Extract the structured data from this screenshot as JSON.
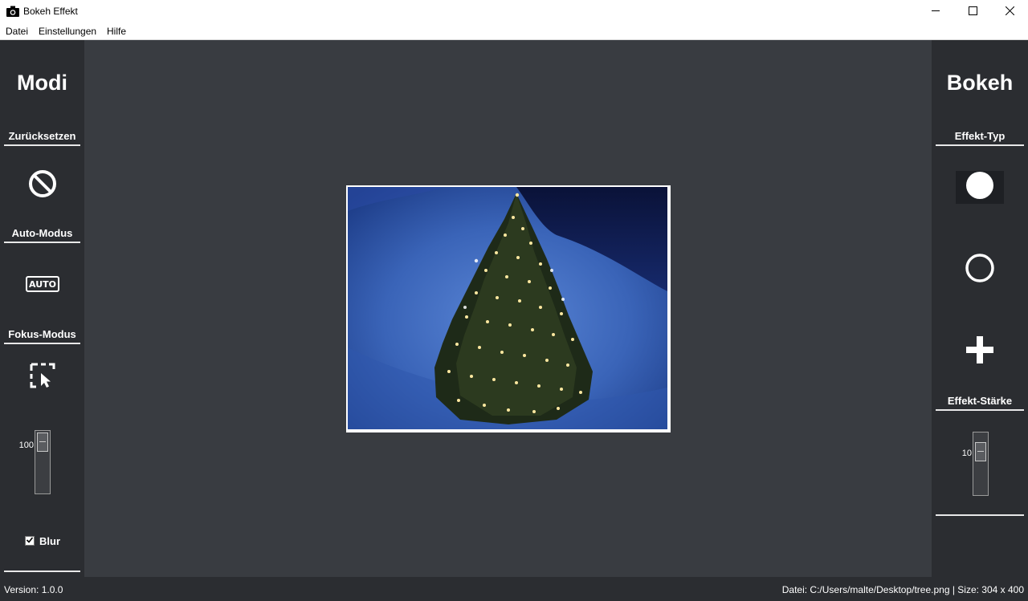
{
  "window": {
    "title": "Bokeh Effekt",
    "controls": [
      "minimize-icon",
      "maximize-icon",
      "close-icon"
    ]
  },
  "menu": {
    "items": [
      "Datei",
      "Einstellungen",
      "Hilfe"
    ]
  },
  "left_panel": {
    "title": "Modi",
    "reset_label": "Zurücksetzen",
    "reset_icon": "prohibited-icon",
    "auto_label": "Auto-Modus",
    "auto_icon": "auto-icon",
    "auto_icon_text": "AUTO",
    "focus_label": "Fokus-Modus",
    "focus_icon": "select-cursor-icon",
    "slider_value": "100",
    "blur_label": "Blur",
    "blur_checked": true
  },
  "right_panel": {
    "title": "Bokeh",
    "effect_type_label": "Effekt-Typ",
    "effect_types": [
      "filled-circle-icon",
      "ring-icon",
      "plus-icon"
    ],
    "selected_effect": "filled-circle-icon",
    "strength_label": "Effekt-Stärke",
    "strength_value": "10"
  },
  "image": {
    "subject": "christmas-tree-photo"
  },
  "status": {
    "version": "Version: 1.0.0",
    "file_info": "Datei: C:/Users/malte/Desktop/tree.png | Size: 304 x 400"
  },
  "colors": {
    "panel_bg": "#2b2d31",
    "canvas_bg": "#393c41",
    "text": "#ffffff"
  }
}
